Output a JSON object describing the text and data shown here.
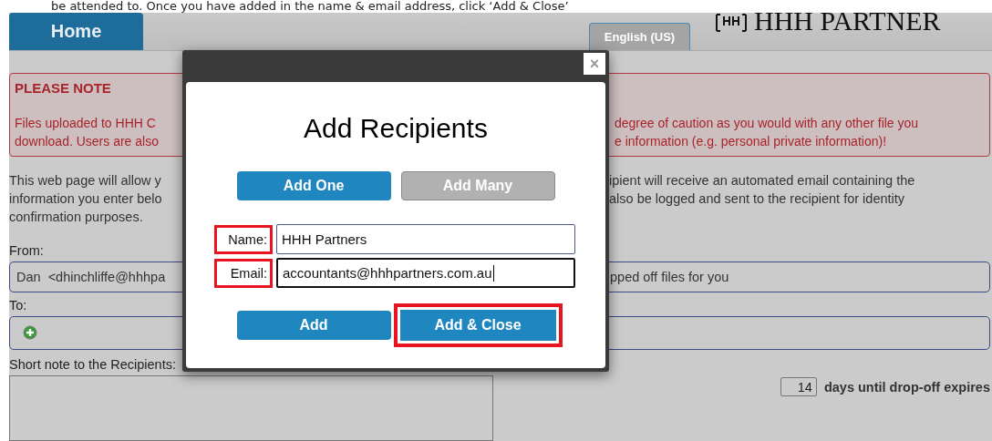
{
  "doc_text": "be attended to. Once you have added in the name & email address, click ‘Add & Close’",
  "nav_tab": {
    "label": "Home",
    "selected": true
  },
  "language_tab": {
    "label": "English (US)"
  },
  "logo": {
    "text": "HHH PARTNER"
  },
  "notice": {
    "title": "PLEASE NOTE",
    "left_lines": [
      "Files uploaded to HHH C",
      "download. Users are also"
    ],
    "right_lines": [
      "degree of caution as you would with any other file you",
      "e information (e.g. personal private information)!"
    ]
  },
  "intro": {
    "left_lines": [
      "This web page will allow y",
      "information you enter belo",
      "confirmation purposes."
    ],
    "right_lines": [
      "ipient will receive an automated email containing the",
      "also be logged and sent to the recipient for identity"
    ]
  },
  "from": {
    "label": "From:",
    "value_left": "Dan  <dhinchliffe@hhhpa",
    "value_right": "pped off files for you"
  },
  "to": {
    "label": "To:"
  },
  "note": {
    "label": "Short note to the Recipients:"
  },
  "expiry": {
    "days": "14",
    "label": "days until drop-off expires"
  },
  "dialog": {
    "title": "Add Recipients",
    "close": "×",
    "modes": [
      {
        "label": "Add One",
        "selected": true
      },
      {
        "label": "Add Many",
        "selected": false
      }
    ],
    "fields": [
      {
        "label": "Name:",
        "value": "HHH Partners",
        "focused": false,
        "highlighted": true
      },
      {
        "label": "Email:",
        "value": "accountants@hhhpartners.com.au",
        "focused": true,
        "highlighted": true
      }
    ],
    "actions": [
      {
        "label": "Add",
        "highlighted": false
      },
      {
        "label": "Add & Close",
        "highlighted": true
      }
    ]
  }
}
